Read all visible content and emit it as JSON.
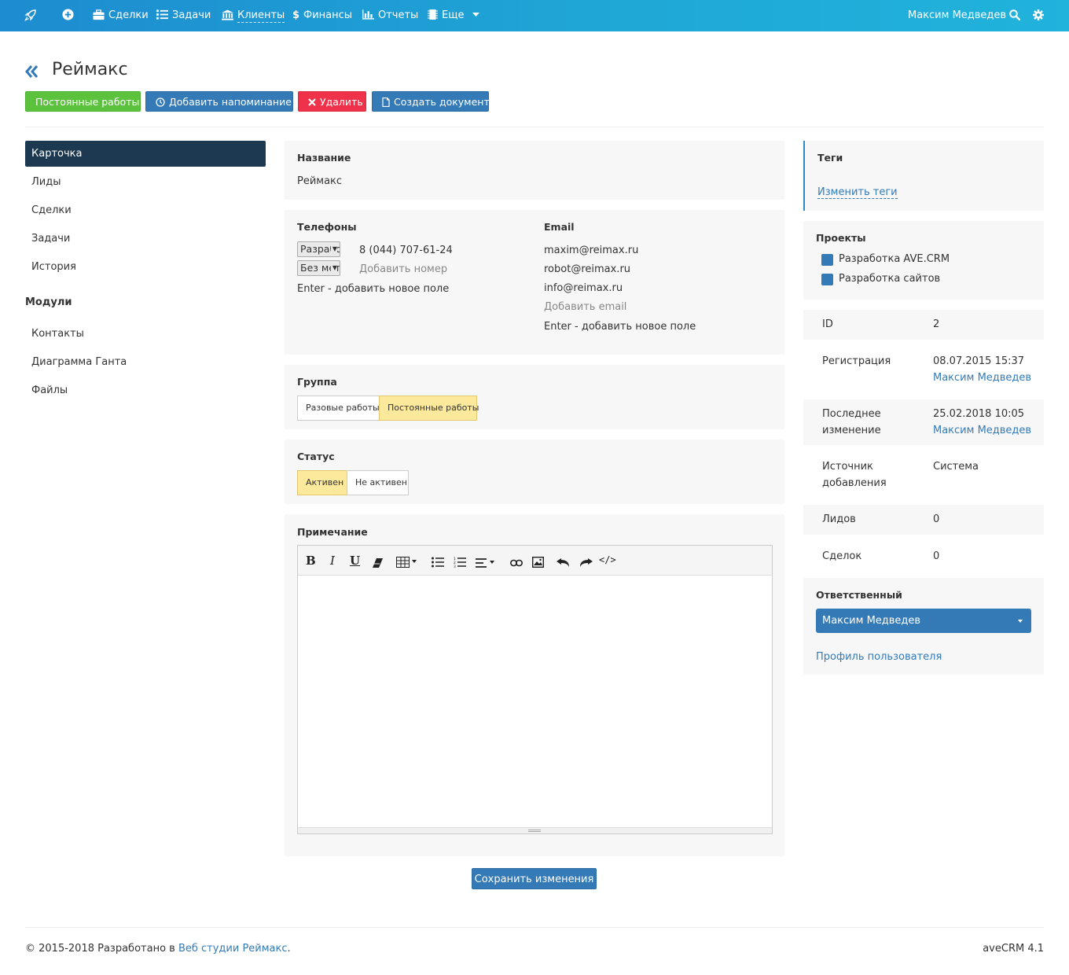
{
  "nav": {
    "deals": "Сделки",
    "tasks": "Задачи",
    "clients": "Клиенты",
    "finance": "Финансы",
    "reports": "Отчеты",
    "more": "Еще",
    "user": "Максим Медведев"
  },
  "header": {
    "title": "Реймакс",
    "buttons": {
      "permanent": "Постоянные работы",
      "reminder": "Добавить напоминание",
      "delete": "Удалить",
      "document": "Создать документ"
    }
  },
  "sidebar": {
    "items": [
      "Карточка",
      "Лиды",
      "Сделки",
      "Задачи",
      "История"
    ],
    "modules_heading": "Модули",
    "modules": [
      "Контакты",
      "Диаграмма Ганта",
      "Файлы"
    ]
  },
  "card": {
    "name_label": "Название",
    "name_value": "Реймакс",
    "phones_label": "Телефоны",
    "phone_type_1": "Разработка",
    "phone_type_2": "Без метки",
    "phone_1": "8 (044) 707-61-24",
    "add_phone": "Добавить номер",
    "phone_hint": "Enter - добавить новое поле",
    "email_label": "Email",
    "emails": [
      "maxim@reimax.ru",
      "robot@reimax.ru",
      "info@reimax.ru"
    ],
    "add_email": "Добавить email",
    "email_hint": "Enter - добавить новое поле",
    "group_label": "Группа",
    "group_options": [
      "Разовые работы",
      "Постоянные работы"
    ],
    "status_label": "Статус",
    "status_options": [
      "Активен",
      "Не активен"
    ],
    "note_label": "Примечание",
    "save": "Сохранить изменения"
  },
  "right": {
    "tags_label": "Теги",
    "edit_tags": "Изменить теги",
    "projects_label": "Проекты",
    "projects": [
      "Разработка AVE.CRM",
      "Разработка сайтов"
    ],
    "id_label": "ID",
    "id_value": "2",
    "reg_label": "Регистрация",
    "reg_date": "08.07.2015 15:37",
    "reg_user": "Максим Медведев",
    "mod_label_1": "Последнее",
    "mod_label_2": "изменение",
    "mod_date": "25.02.2018 10:05",
    "mod_user": "Максим Медведев",
    "src_label_1": "Источник",
    "src_label_2": "добавления",
    "src_value": "Система",
    "leads_label": "Лидов",
    "leads_value": "0",
    "deals_label": "Сделок",
    "deals_value": "0",
    "resp_label": "Ответственный",
    "resp_value": "Максим Медведев",
    "profile_link": "Профиль пользователя"
  },
  "footer": {
    "copyright": "© 2015-2018 Разработано в ",
    "studio": "Веб студии Реймакс",
    "dot": ".",
    "version": "aveCRM 4.1"
  },
  "colors": {
    "nav_gradient_start": "#1d8cd0",
    "nav_gradient_end": "#20b3dc",
    "primary": "#337ab7",
    "success": "#5cc23e",
    "danger": "#f0314a",
    "sidebar_active": "#1c3951",
    "selected_segment": "#fde99b"
  },
  "icons": [
    "rocket-icon",
    "plus-circle-icon",
    "briefcase-icon",
    "list-icon",
    "bank-icon",
    "dollar-icon",
    "bar-chart-icon",
    "chip-icon",
    "search-icon",
    "gear-icon",
    "double-chevron-left-icon",
    "clock-icon",
    "x-icon",
    "document-icon"
  ]
}
